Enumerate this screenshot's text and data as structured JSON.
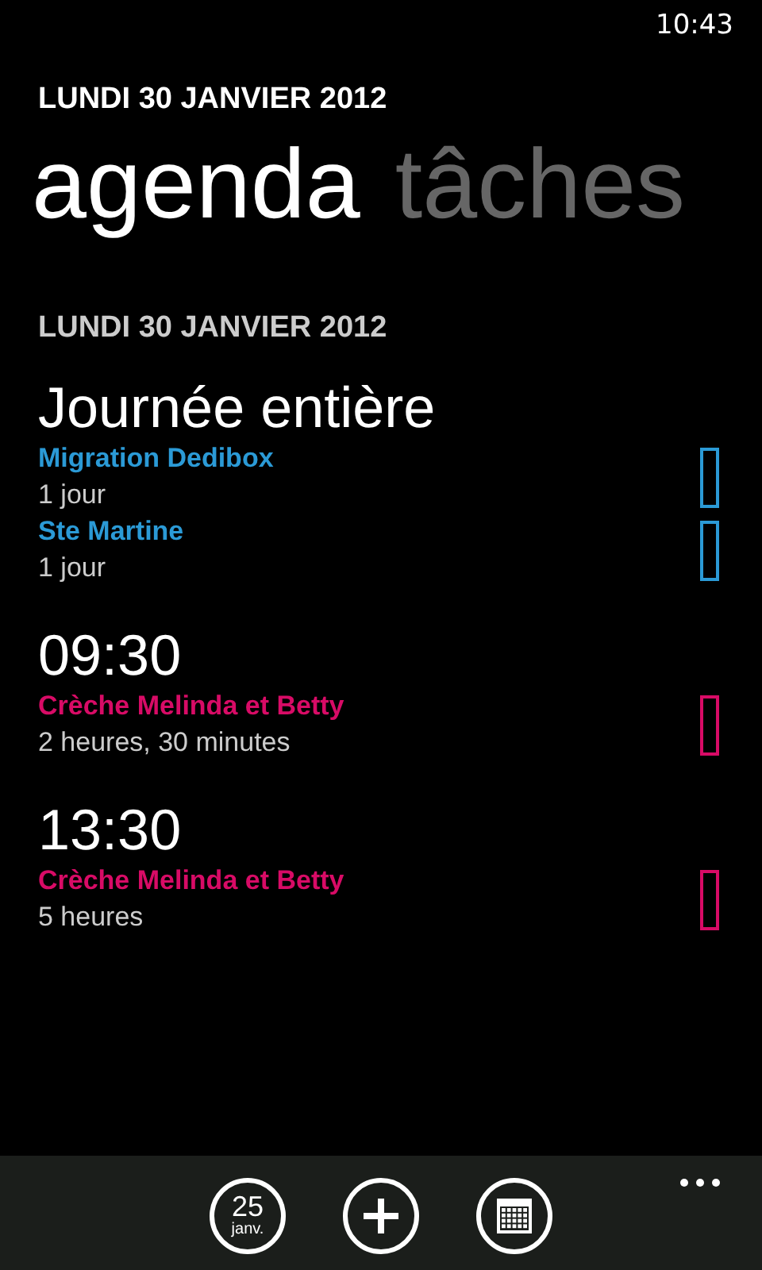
{
  "status_bar": {
    "time": "10:43"
  },
  "header": {
    "date": "LUNDI 30 JANVIER 2012"
  },
  "pivots": [
    {
      "label": "agenda",
      "selected": true
    },
    {
      "label": "tâches",
      "selected": false
    }
  ],
  "day": {
    "date": "LUNDI 30 JANVIER 2012"
  },
  "groups": [
    {
      "heading": "Journée entière",
      "events": [
        {
          "title": "Migration Dedibox",
          "duration": "1 jour",
          "color": "#2b9ad6"
        },
        {
          "title": "Ste Martine",
          "duration": "1 jour",
          "color": "#2b9ad6"
        }
      ]
    },
    {
      "heading": "09:30",
      "events": [
        {
          "title": "Crèche Melinda et Betty",
          "duration": "2 heures, 30 minutes",
          "color": "#d80b66"
        }
      ]
    },
    {
      "heading": "13:30",
      "events": [
        {
          "title": "Crèche Melinda et Betty",
          "duration": "5 heures",
          "color": "#d80b66"
        }
      ]
    }
  ],
  "app_bar": {
    "buttons": [
      {
        "kind": "today",
        "day": "25",
        "month": "janv."
      },
      {
        "kind": "add"
      },
      {
        "kind": "month"
      }
    ]
  }
}
